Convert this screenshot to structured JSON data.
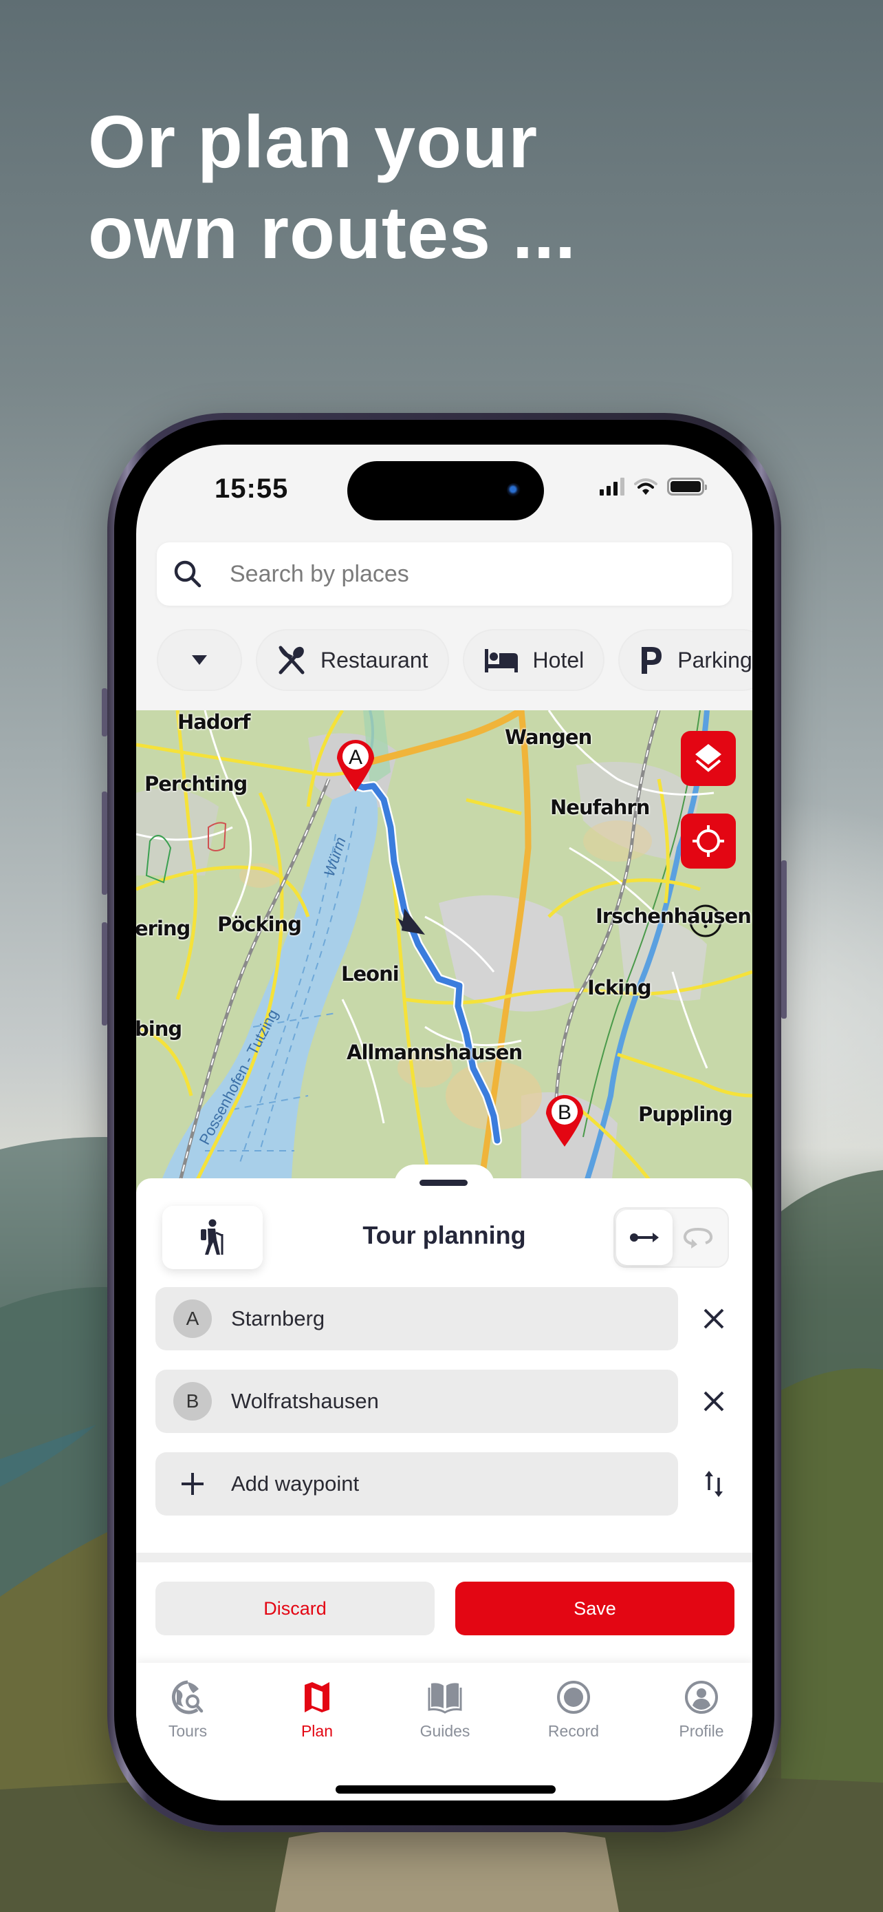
{
  "headline": {
    "line1": "Or plan your",
    "line2": "own routes ..."
  },
  "status_bar": {
    "time": "15:55"
  },
  "search": {
    "placeholder": "Search by places",
    "value": ""
  },
  "filter_chips": [
    {
      "label": "",
      "icon": "dropdown-triangle"
    },
    {
      "label": "Restaurant",
      "icon": "fork-knife-icon"
    },
    {
      "label": "Hotel",
      "icon": "bed-icon"
    },
    {
      "label": "Parking",
      "icon": "parking-p-icon"
    }
  ],
  "map": {
    "labels": [
      "Hadorf",
      "Wangen",
      "Perchting",
      "Neufahrn",
      "Pöcking",
      "ering",
      "Irschenhausen",
      "Leoni",
      "Icking",
      "bing",
      "Allmannshausen",
      "Puppling"
    ],
    "water_labels": [
      "Würm",
      "Possenhofen - Tutzing"
    ],
    "start_marker": "A",
    "end_marker": "B",
    "buttons": {
      "layers": "layers-icon",
      "locate": "locate-icon"
    },
    "route_color": "#3b7ddd",
    "marker_color": "#e30613"
  },
  "tour_planning": {
    "title": "Tour planning",
    "mode": "hiking",
    "route_type_options": [
      "one-way",
      "round-trip"
    ],
    "route_type_selected": "one-way",
    "waypoints": [
      {
        "badge": "A",
        "name": "Starnberg"
      },
      {
        "badge": "B",
        "name": "Wolfratshausen"
      }
    ],
    "add_waypoint_label": "Add waypoint",
    "discard_label": "Discard",
    "save_label": "Save"
  },
  "tabbar": {
    "items": [
      {
        "label": "Tours",
        "icon": "globe-search-icon",
        "active": false
      },
      {
        "label": "Plan",
        "icon": "map-icon",
        "active": true
      },
      {
        "label": "Guides",
        "icon": "book-icon",
        "active": false
      },
      {
        "label": "Record",
        "icon": "record-icon",
        "active": false
      },
      {
        "label": "Profile",
        "icon": "profile-icon",
        "active": false
      }
    ]
  },
  "colors": {
    "accent": "#e30613",
    "text_dark": "#25273a",
    "tab_inactive": "#8a8f99"
  }
}
